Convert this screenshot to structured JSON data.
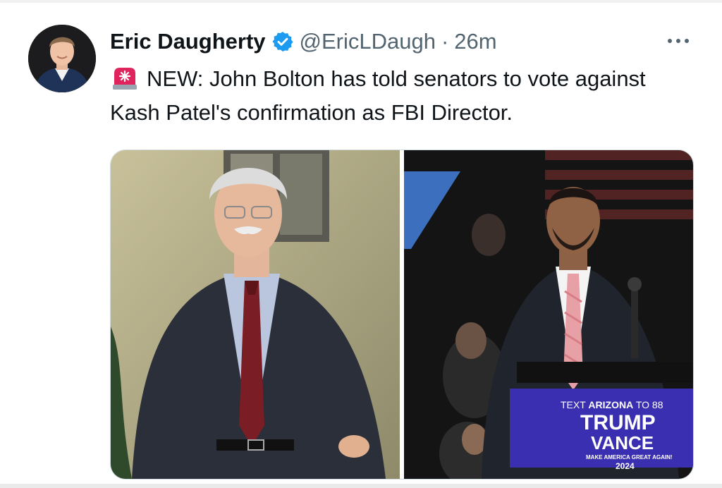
{
  "author": {
    "name": "Eric Daugherty",
    "handle": "@EricLDaugh",
    "separator": "·",
    "time": "26m"
  },
  "tweet": {
    "emoji": "rotating-light-icon",
    "text": "NEW: John Bolton has told senators to vote against Kash Patel's confirmation as FBI Director."
  },
  "media": {
    "sign": {
      "line1_prefix": "TEXT ",
      "line1_bold": "ARIZONA",
      "line1_suffix": " TO 88",
      "line2": "TRUMP",
      "line3": "VANCE",
      "line4": "MAKE AMERICA GREAT AGAIN!",
      "line5": "2024"
    }
  },
  "colors": {
    "accent_verified": "#1d9bf0",
    "text_primary": "#0f1419",
    "text_secondary": "#536471",
    "siren_red": "#e0245e"
  }
}
